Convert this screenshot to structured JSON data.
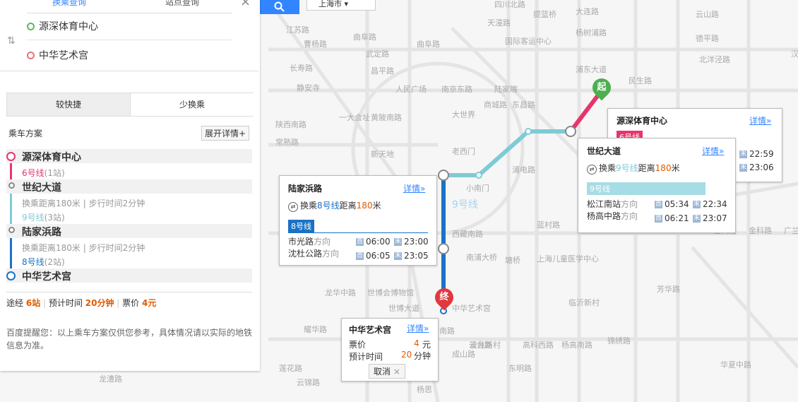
{
  "search": {
    "tab_transfer": "换乘查询",
    "tab_station": "站点查询",
    "start_value": "源深体育中心",
    "end_value": "中华艺术宫",
    "city": "上海市"
  },
  "options": {
    "fast": "较快捷",
    "less_transfer": "少换乘"
  },
  "plan": {
    "title": "乘车方案",
    "expand": "展开详情+",
    "stops": [
      {
        "name": "源深体育中心",
        "line": "6号线",
        "count": "(1站)"
      },
      {
        "name": "世纪大道",
        "transfer": "换乘距离180米 | 步行时间2分钟",
        "line": "9号线",
        "count": "(3站)"
      },
      {
        "name": "陆家浜路",
        "transfer": "换乘距离180米 | 步行时间2分钟",
        "line": "8号线",
        "count": "(2站)"
      },
      {
        "name": "中华艺术宫"
      }
    ],
    "summary": {
      "via": "途经",
      "stations": "6站",
      "time_label": "预计时间",
      "time": "20分钟",
      "fare_label": "票价",
      "fare": "4元"
    },
    "note": "百度提醒您：以上乘车方案仅供您参考，具体情况请以实际的地铁信息为准。"
  },
  "popups": {
    "yuanshen": {
      "title": "源深体育中心",
      "more": "详情»",
      "line": "6号线",
      "end1": "22:59",
      "end2": "23:06"
    },
    "shiji": {
      "title": "世纪大道",
      "more": "详情»",
      "transfer_pre": "换乘",
      "transfer_line": "9号线",
      "transfer_mid": "距离",
      "transfer_dist": "180",
      "transfer_unit": "米",
      "line": "9号线",
      "dir1": "松江南站",
      "dir2": "杨高中路",
      "dir_suffix": "方向",
      "first1": "05:34",
      "last1": "22:34",
      "first2": "06:21",
      "last2": "23:07"
    },
    "lujia": {
      "title": "陆家浜路",
      "more": "详情»",
      "transfer_pre": "换乘",
      "transfer_line": "8号线",
      "transfer_mid": "距离",
      "transfer_dist": "180",
      "transfer_unit": "米",
      "line": "8号线",
      "dir1": "市光路",
      "dir2": "沈杜公路",
      "dir_suffix": "方向",
      "first1": "06:00",
      "last1": "23:00",
      "first2": "06:05",
      "last2": "23:05"
    },
    "zhonghua": {
      "title": "中华艺术宫",
      "more": "详情»",
      "fare_label": "票价",
      "fare": "4",
      "fare_unit": "元",
      "time_label": "预计时间",
      "time": "20",
      "time_unit": "分钟",
      "cancel": "取消"
    }
  },
  "map": {
    "start_marker": "起",
    "end_marker": "终",
    "line9_label": "9号线",
    "tag_first": "首",
    "tag_last": "末",
    "labels": [
      "中华艺术宫",
      "上海儿童医学中心",
      "塘桥",
      "世博大道",
      "云台路",
      "高科西路",
      "杨高南路",
      "锦绣路",
      "芳华路",
      "龙华中路",
      "世博会博物馆",
      "西藏南路",
      "南浦大桥",
      "蓝村路",
      "临沂新村",
      "浦电路",
      "小南门",
      "老西门",
      "新天地",
      "大世界",
      "人民广场",
      "南京东路",
      "陆家嘴",
      "东昌路",
      "商城路",
      "四川北路",
      "天潼路",
      "国际客运中心",
      "提篮桥",
      "大连路",
      "杨树浦路",
      "浦东大道",
      "民生路",
      "云山路",
      "德平路",
      "北洋泾路",
      "曲阜路",
      "武定路",
      "昌平路",
      "静安寺",
      "长寿路",
      "常熟路",
      "陕西南路",
      "一大会址",
      "黄陂南路",
      "曹杨路",
      "金科路",
      "金科路",
      "广兰路",
      "龙阳路",
      "华夏中路",
      "东明路",
      "凌兆新村",
      "杨思",
      "灵岩南路",
      "成山路",
      "耀华路",
      "莲花路",
      "龙漕路",
      "云锦路",
      "汉中路",
      "曲阜路",
      "江苏路"
    ]
  },
  "colors": {
    "line6": "#e8356b",
    "line9": "#7ecbd6",
    "line8": "#1a72c6",
    "accent": "#3385ff",
    "orange": "#e05a00"
  }
}
